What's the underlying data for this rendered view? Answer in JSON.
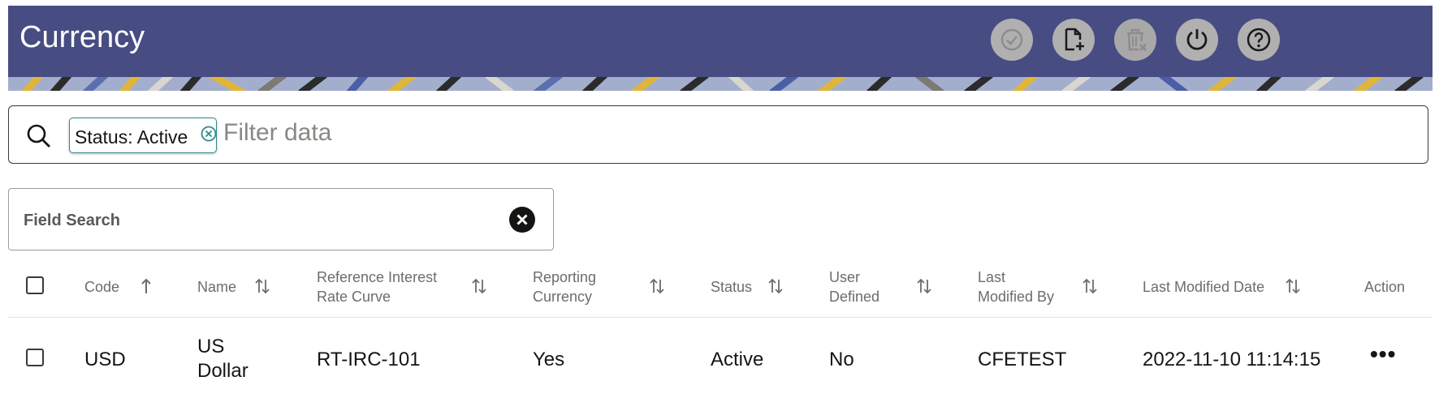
{
  "header": {
    "title": "Currency",
    "toolbar": [
      {
        "icon": "approve-icon",
        "label": "Approve"
      },
      {
        "icon": "new-document-icon",
        "label": "Add"
      },
      {
        "icon": "delete-icon",
        "label": "Delete"
      },
      {
        "icon": "power-icon",
        "label": "Refresh"
      },
      {
        "icon": "help-icon",
        "label": "Help"
      }
    ],
    "bg_color": "#474d82"
  },
  "filter": {
    "chip_label": "Status: Active",
    "placeholder": "Filter data",
    "chip_color": "#2e8a8c"
  },
  "field_search": {
    "label": "Field Search"
  },
  "table": {
    "columns": [
      {
        "label": "Code",
        "sort": "ascending"
      },
      {
        "label": "Name",
        "sort": "none"
      },
      {
        "label": "Reference Interest Rate Curve",
        "line1": "Reference Interest",
        "line2": "Rate Curve",
        "sort": "none"
      },
      {
        "label": "Reporting Currency",
        "line1": "Reporting",
        "line2": "Currency",
        "sort": "none"
      },
      {
        "label": "Status",
        "sort": "none"
      },
      {
        "label": "User Defined",
        "line1": "User",
        "line2": "Defined",
        "sort": "none"
      },
      {
        "label": "Last Modified By",
        "line1": "Last",
        "line2": "Modified By",
        "sort": "none"
      },
      {
        "label": "Last Modified Date",
        "sort": "none"
      },
      {
        "label": "Action"
      }
    ],
    "rows": [
      {
        "code": "USD",
        "name_line1": "US",
        "name_line2": "Dollar",
        "ref_curve": "RT-IRC-101",
        "reporting": "Yes",
        "status": "Active",
        "user_defined": "No",
        "modified_by": "CFETEST",
        "modified_date": "2022-11-10 11:14:15",
        "action": "•••"
      }
    ]
  }
}
